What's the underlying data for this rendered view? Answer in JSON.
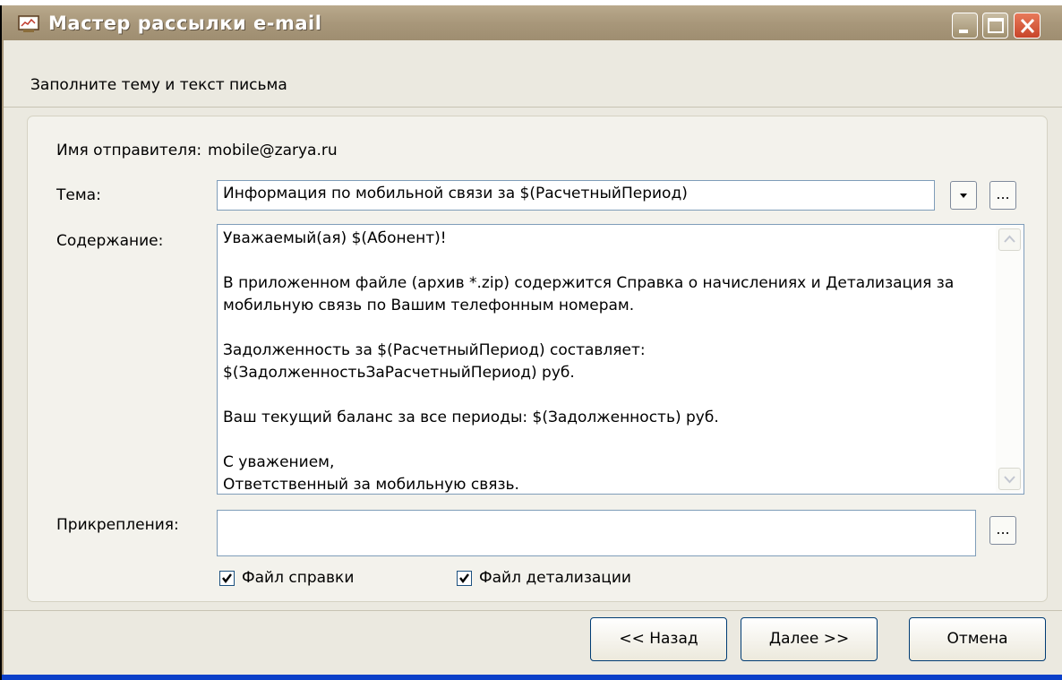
{
  "window": {
    "title": "Мастер рассылки e-mail",
    "icons": {
      "app": "mail-window-icon",
      "minimize": "minimize-icon",
      "maximize": "maximize-icon",
      "close": "close-icon"
    }
  },
  "header": {
    "instruction": "Заполните тему и текст письма"
  },
  "form": {
    "sender_label": "Имя отправителя:",
    "sender_value": "mobile@zarya.ru",
    "subject_label": "Тема:",
    "subject_value": "Информация по мобильной связи за $(РасчетныйПериод)",
    "browse_label": "...",
    "content_label": "Содержание:",
    "content_lines": [
      "Уважаемый(ая) $(Абонент)!",
      "",
      "В приложенном файле (архив *.zip) содержится Справка о начислениях и Детализация за",
      "мобильную связь по Вашим телефонным номерам.",
      "",
      "Задолженность за $(РасчетныйПериод) составляет:",
      "$(ЗадолженностьЗаРасчетныйПериод) руб.",
      "",
      "Ваш текущий баланс за все периоды: $(Задолженность) руб.",
      "",
      "С уважением,",
      "Ответственный за мобильную связь."
    ],
    "attachments_label": "Прикрепления:",
    "attachments_value": "",
    "checkbox_report": {
      "label": "Файл справки",
      "checked": true
    },
    "checkbox_detail": {
      "label": "Файл детализации",
      "checked": true
    }
  },
  "footer": {
    "back": "<< Назад",
    "next": "Далее >>",
    "cancel": "Отмена"
  }
}
